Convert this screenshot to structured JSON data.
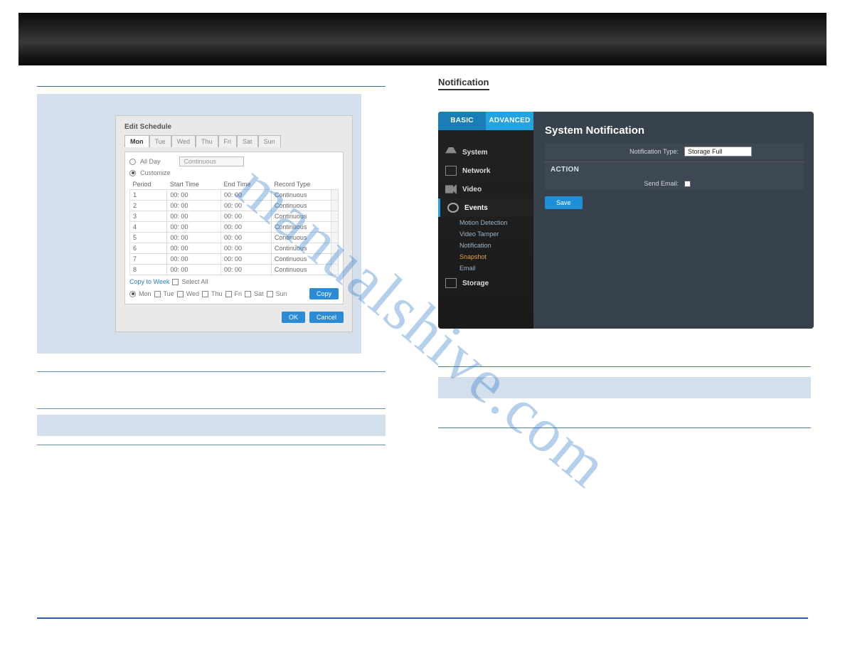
{
  "left": {
    "es_title": "Edit Schedule",
    "days": [
      "Mon",
      "Tue",
      "Wed",
      "Thu",
      "Fri",
      "Sat",
      "Sun"
    ],
    "allday": "All Day",
    "customize": "Customize",
    "type_sel": "Continuous",
    "th_period": "Period",
    "th_start": "Start Time",
    "th_end": "End Time",
    "th_type": "Record Type",
    "rows": [
      {
        "p": "1",
        "s": "00: 00",
        "e": "00: 00",
        "t": "Continuous"
      },
      {
        "p": "2",
        "s": "00: 00",
        "e": "00: 00",
        "t": "Continuous"
      },
      {
        "p": "3",
        "s": "00: 00",
        "e": "00: 00",
        "t": "Continuous"
      },
      {
        "p": "4",
        "s": "00: 00",
        "e": "00: 00",
        "t": "Continuous"
      },
      {
        "p": "5",
        "s": "00: 00",
        "e": "00: 00",
        "t": "Continuous"
      },
      {
        "p": "6",
        "s": "00: 00",
        "e": "00: 00",
        "t": "Continuous"
      },
      {
        "p": "7",
        "s": "00: 00",
        "e": "00: 00",
        "t": "Continuous"
      },
      {
        "p": "8",
        "s": "00: 00",
        "e": "00: 00",
        "t": "Continuous"
      }
    ],
    "copy_to_week": "Copy to Week",
    "select_all": "Select All",
    "btn_copy": "Copy",
    "btn_ok": "OK",
    "btn_cancel": "Cancel"
  },
  "right": {
    "title": "Notification",
    "tab_basic": "BASIC",
    "tab_adv": "ADVANCED",
    "nav_system": "System",
    "nav_network": "Network",
    "nav_video": "Video",
    "nav_events": "Events",
    "nav_storage": "Storage",
    "sub_motion": "Motion Detection",
    "sub_tamper": "Video Tamper",
    "sub_notif": "Notification",
    "sub_snap": "Snapshot",
    "sub_email": "Email",
    "heading": "System Notification",
    "notif_type_label": "Notification Type:",
    "notif_type_val": "Storage Full",
    "action": "ACTION",
    "send_email": "Send Email:",
    "save": "Save"
  },
  "watermark": "manualshive.com"
}
